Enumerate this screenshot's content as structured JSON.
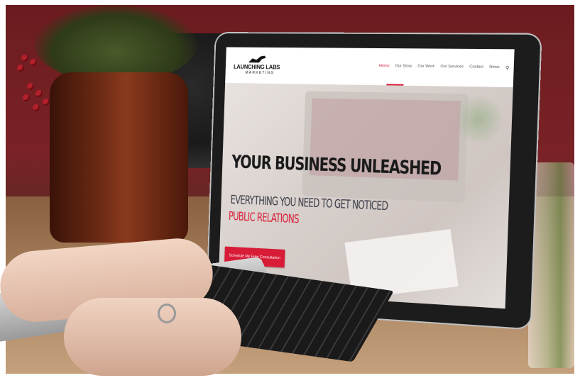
{
  "site": {
    "logo_name": "LAUNCHING LABS",
    "logo_sub": "MARKETING"
  },
  "nav": {
    "items": [
      "Home",
      "Our Story",
      "Our Work",
      "Our Services",
      "Contact",
      "News"
    ],
    "active": "Home",
    "search_icon": "search-icon"
  },
  "hero": {
    "headline": "YOUR BUSINESS UNLEASHED",
    "subheadline": "EVERYTHING YOU NEED TO GET NOTICED",
    "rotating_text": "PUBLIC RELATIONS",
    "cta_label": "Schedule My Free Consultation"
  },
  "colors": {
    "accent": "#d81c38",
    "text_dark": "#1a1a1a",
    "subtext": "#3a3c48"
  }
}
